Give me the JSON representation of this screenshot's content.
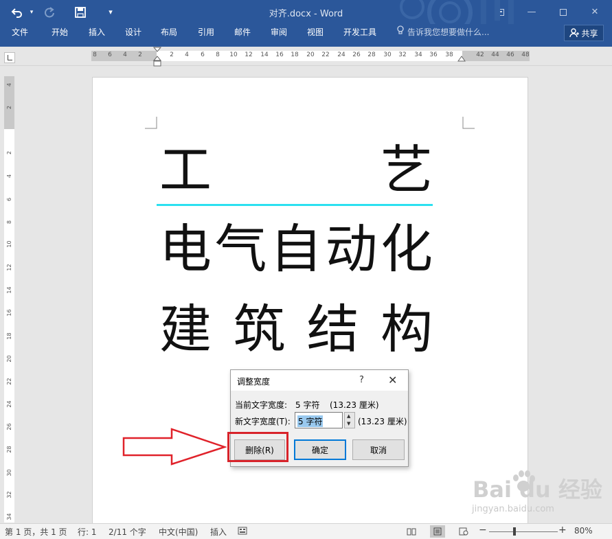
{
  "window": {
    "title": "对齐.docx - Word",
    "undo_icon": "undo-icon",
    "redo_icon": "redo-icon",
    "save_icon": "save-icon",
    "customize_icon": "qat-dropdown-icon"
  },
  "ribbon": {
    "tabs": [
      "文件",
      "开始",
      "插入",
      "设计",
      "布局",
      "引用",
      "邮件",
      "审阅",
      "视图",
      "开发工具"
    ],
    "tell_me": "告诉我您想要做什么...",
    "share": "共享"
  },
  "ruler": {
    "h_numbers": [
      "8",
      "6",
      "4",
      "2",
      "2",
      "4",
      "6",
      "8",
      "10",
      "12",
      "14",
      "16",
      "18",
      "20",
      "22",
      "24",
      "26",
      "28",
      "30",
      "32",
      "34",
      "36",
      "38",
      "42",
      "44",
      "46",
      "48"
    ],
    "v_numbers": [
      "4",
      "2",
      "2",
      "4",
      "6",
      "8",
      "10",
      "12",
      "14",
      "16",
      "18",
      "20",
      "22",
      "24",
      "26",
      "28",
      "30",
      "32",
      "34"
    ]
  },
  "document": {
    "line1": [
      "工",
      "艺"
    ],
    "line2": [
      "电",
      "气",
      "自",
      "动",
      "化"
    ],
    "line3": [
      "建",
      "筑",
      "结",
      "构"
    ]
  },
  "dialog": {
    "title": "调整宽度",
    "help": "?",
    "close": "✕",
    "current_label": "当前文字宽度:",
    "current_value": "5 字符",
    "current_metric": "(13.23 厘米)",
    "new_label": "新文字宽度(T):",
    "new_value": "5 字符",
    "new_metric": "(13.23 厘米)",
    "delete_button": "删除(R)",
    "ok_button": "确定",
    "cancel_button": "取消"
  },
  "status": {
    "page": "第 1 页，共 1 页",
    "line": "行: 1",
    "words": "2/11 个字",
    "language": "中文(中国)",
    "mode": "插入",
    "zoom": "80%",
    "zoom_minus": "−",
    "zoom_plus": "+"
  },
  "watermark": {
    "main": "Bai du 经验",
    "sub": "jingyan.baidu.com"
  },
  "colors": {
    "ribbon": "#2b579a",
    "underline": "#2ce0f0",
    "highlight": "#d8232a",
    "arrow": "#e0222a"
  }
}
